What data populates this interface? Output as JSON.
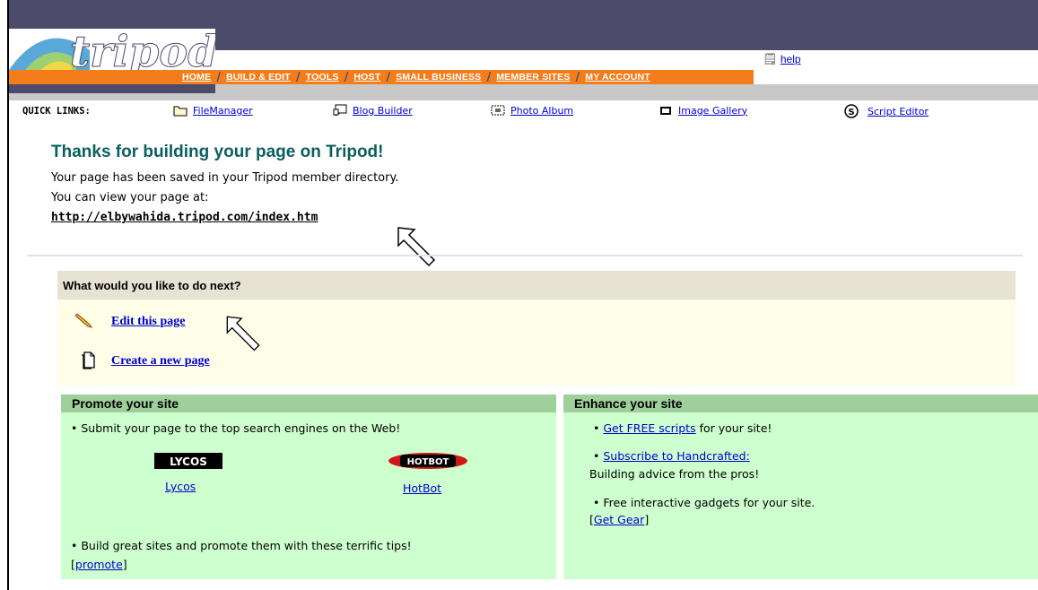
{
  "colors": {
    "slate": "#4c4b6a",
    "orange": "#f47d1b",
    "teal_title": "#0b5f5f",
    "link": "#0000cc",
    "next_head_bg": "#e6e3d3",
    "next_body_bg": "#fefde8",
    "panel_bg": "#ceffce",
    "panel_head_bg": "#9fcf9b"
  },
  "header": {
    "logo_text": "tripod",
    "help_label": "help",
    "help_icon": "help-page-icon",
    "nav": [
      "HOME",
      "BUILD & EDIT",
      "TOOLS",
      "HOST",
      "SMALL BUSINESS",
      "MEMBER SITES",
      "MY ACCOUNT"
    ]
  },
  "quick_links": {
    "label": "QUICK LINKS:",
    "items": [
      {
        "label": "FileManager",
        "icon": "folder-icon"
      },
      {
        "label": "Blog Builder",
        "icon": "blog-icon"
      },
      {
        "label": "Photo Album",
        "icon": "photo-icon"
      },
      {
        "label": "Image Gallery",
        "icon": "gallery-icon"
      },
      {
        "label": "Script Editor",
        "icon": "script-icon"
      }
    ]
  },
  "main": {
    "title": "Thanks for building your page on Tripod!",
    "line1": "Your page has been saved in your Tripod member directory.",
    "line2": "You can view your page at:",
    "url": "http://elbywahida.tripod.com/index.htm"
  },
  "next": {
    "heading": "What would you like to do next?",
    "edit_label": "Edit this page",
    "edit_icon": "pencil-icon",
    "create_label": "Create a new page",
    "create_icon": "new-page-icon"
  },
  "promote": {
    "heading": "Promote your site",
    "submit_text": "• Submit your page to the top search engines on the Web!",
    "lycos_logo": "LYCOS",
    "lycos_label": "Lycos",
    "hotbot_logo": "HOTBOT",
    "hotbot_label": "HotBot",
    "tips_text": "• Build great sites and promote them with these terrific tips!",
    "promote_link": "promote"
  },
  "enhance": {
    "heading": "Enhance your site",
    "scripts_link": "Get FREE scripts",
    "scripts_suffix": " for your site!",
    "subscribe_link": "Subscribe to Handcrafted:",
    "subscribe_sub": "Building advice from the pros!",
    "gadgets_text": "• Free interactive gadgets for your site.",
    "gear_link": "Get Gear"
  }
}
